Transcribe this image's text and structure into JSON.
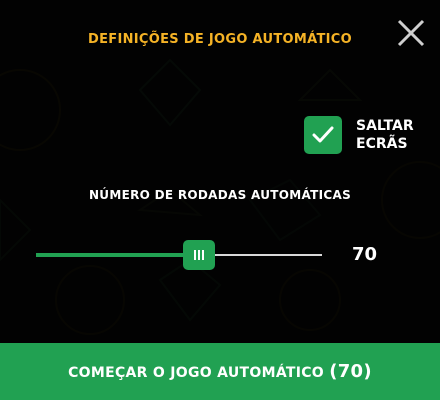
{
  "dialog": {
    "title": "DEFINIÇÕES DE JOGO AUTOMÁTICO",
    "close_icon": "close-icon"
  },
  "skip_screens": {
    "label": "SALTAR\nECRÃS",
    "checked": true
  },
  "auto_spins": {
    "label": "NÚMERO DE RODADAS AUTOMÁTICAS",
    "value": "70",
    "fraction": 0.57
  },
  "start_button": {
    "label": "COMEÇAR O JOGO AUTOMÁTICO",
    "count": "(70)"
  },
  "colors": {
    "accent": "#21a152",
    "title": "#f5b326",
    "background": "#0b0b0b"
  }
}
